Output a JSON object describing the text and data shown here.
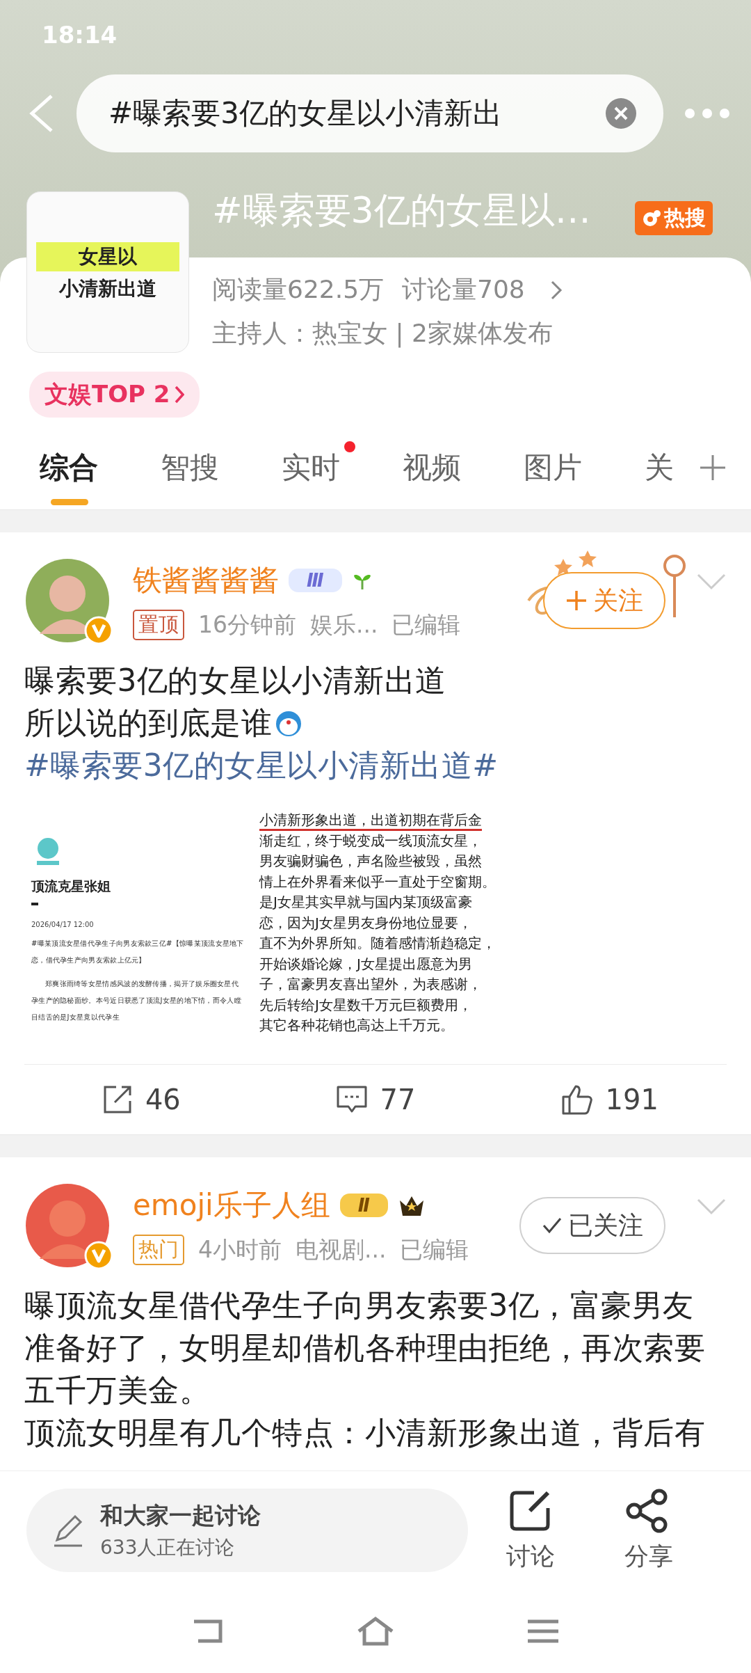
{
  "status_bar": {
    "time": "18:14"
  },
  "search": {
    "value": "#曝索要3亿的女星以小清新出"
  },
  "topic": {
    "thumb_lines": [
      "女星以",
      "小清新出道"
    ],
    "title": "#曝索要3亿的女星以…",
    "badge": "热搜",
    "stats": [
      "阅读量622.5万",
      "讨论量708"
    ],
    "host": "主持人：热宝女 | 2家媒体发布",
    "rank": "文娱TOP 2"
  },
  "tabs": [
    {
      "label": "综合",
      "selected": true,
      "dot": false
    },
    {
      "label": "智搜",
      "selected": false,
      "dot": false
    },
    {
      "label": "实时",
      "selected": false,
      "dot": true
    },
    {
      "label": "视频",
      "selected": false,
      "dot": false
    },
    {
      "label": "图片",
      "selected": false,
      "dot": false
    },
    {
      "label": "关",
      "selected": false,
      "dot": false
    }
  ],
  "posts": [
    {
      "author": "铁酱酱酱酱",
      "level": "Ⅲ",
      "tag": {
        "label": "置顶",
        "kind": "pinned"
      },
      "time": "16分钟前",
      "source": "娱乐...",
      "edited": "已编辑",
      "follow": {
        "label": "关注",
        "following": false
      },
      "paragraphs": [
        "曝索要3亿的女星以小清新出道",
        "所以说的到底是谁"
      ],
      "hashtag": "#曝索要3亿的女星以小清新出道#",
      "image": {
        "title": "顶流克星张姐",
        "date": "2026/04/17 12:00",
        "left_paragraphs": [
          "#曝某顶流女星借代孕生子向男友索款三亿#【惊曝某顶流女星地下恋，借代孕生产向男友索款上亿元】",
          "郑爽张雨绮等女星情感风波的发酵传播，揭开了娱乐圈女星代孕生产的隐秘面纱。本号近日获悉了顶流J女星的地下情，而令人瞠目结舌的是J女星竟以代孕生"
        ],
        "right_lines": [
          "小清新形象出道，出道初期在背后金",
          "渐走红，终于蜕变成一线顶流女星，",
          "男友骗财骗色，声名险些被毁，虽然",
          "情上在外界看来似乎一直处于空窗期。",
          "是J女星其实早就与国内某顶级富豪",
          "恋，因为J女星男友身份地位显要，",
          "直不为外界所知。随着感情渐趋稳定，",
          "开始谈婚论嫁，J女星提出愿意为男",
          "子，富豪男友喜出望外，为表感谢，",
          "先后转给J女星数千万元巨额费用，",
          "其它各种花销也高达上千万元。"
        ]
      },
      "actions": [
        "46",
        "77",
        "191"
      ]
    },
    {
      "author": "emoji乐子人组",
      "level": "Ⅱ",
      "tag": {
        "label": "热门",
        "kind": "hot"
      },
      "time": "4小时前",
      "source": "电视剧...",
      "edited": "已编辑",
      "follow": {
        "label": "已关注",
        "following": true
      },
      "paragraphs": [
        "曝顶流女星借代孕生子向男友索要3亿，富豪男友准备好了，女明星却借机各种理由拒绝，再次索要五千万美金。",
        "顶流女明星有几个特点：小清新形象出道，背后有"
      ]
    }
  ],
  "bottom_bar": {
    "compose_title": "和大家一起讨论",
    "compose_subtitle": "633人正在讨论",
    "buttons": [
      {
        "label": "讨论",
        "kind": "discuss"
      },
      {
        "label": "分享",
        "kind": "share"
      }
    ]
  }
}
